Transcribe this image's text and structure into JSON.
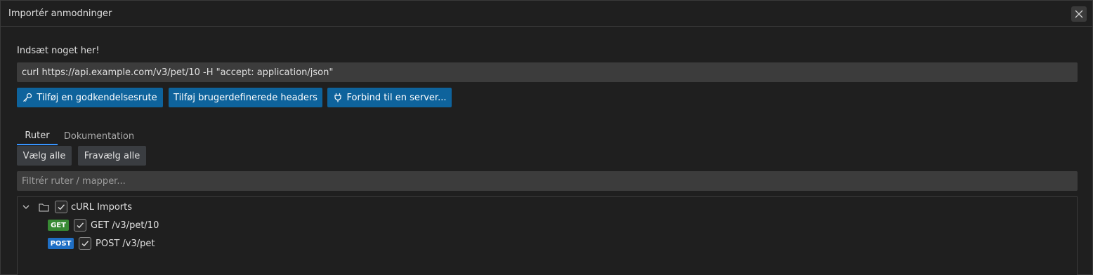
{
  "window": {
    "title": "Importér anmodninger"
  },
  "prompt": {
    "label": "Indsæt noget her!",
    "curl_value": "curl https://api.example.com/v3/pet/10 -H \"accept: application/json\""
  },
  "actions": {
    "auth_route": "Tilføj en godkendelsesrute",
    "custom_headers": "Tilføj brugerdefinerede headers",
    "connect_server": "Forbind til en server..."
  },
  "tabs": [
    {
      "label": "Ruter",
      "active": true
    },
    {
      "label": "Dokumentation",
      "active": false
    }
  ],
  "selection": {
    "select_all": "Vælg alle",
    "deselect_all": "Fravælg alle"
  },
  "filter": {
    "placeholder": "Filtrér ruter / mapper..."
  },
  "tree": {
    "folder": {
      "label": "cURL Imports",
      "checked": true,
      "expanded": true
    },
    "routes": [
      {
        "method": "GET",
        "label": "GET /v3/pet/10",
        "checked": true,
        "method_color": "#388a34"
      },
      {
        "method": "POST",
        "label": "POST /v3/pet",
        "checked": true,
        "method_color": "#1f6fc5"
      }
    ]
  },
  "colors": {
    "primary_button": "#0e639c",
    "secondary_button": "#3a3d41",
    "tab_indicator": "#3794ff",
    "background": "#1f1f1f"
  },
  "icons": {
    "close": "close-icon",
    "key": "key-icon",
    "plug": "plug-icon",
    "chevron": "chevron-down-icon",
    "folder": "folder-icon",
    "check": "check-icon"
  }
}
